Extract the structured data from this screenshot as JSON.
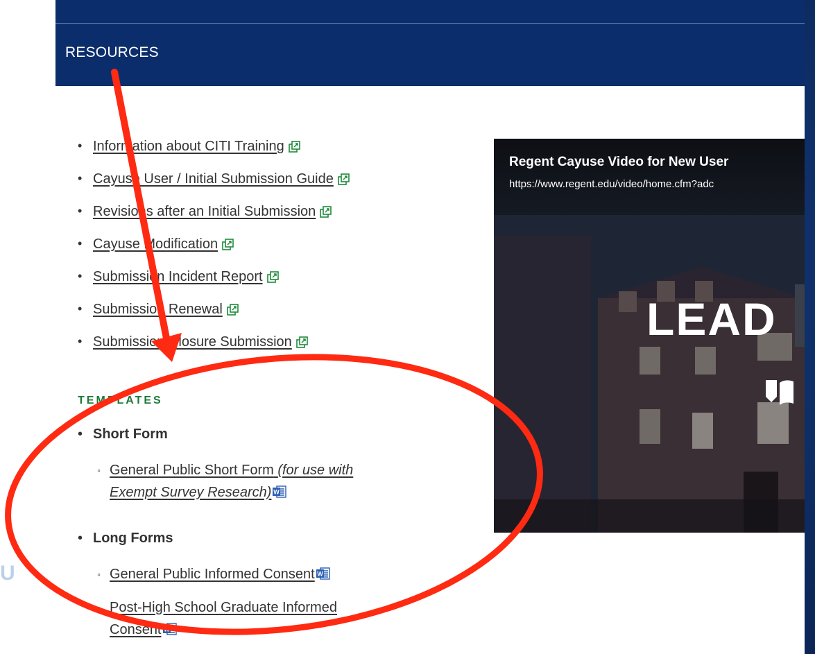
{
  "header": {
    "title": "RESOURCES"
  },
  "resources": [
    {
      "label": "Information about CITI Training"
    },
    {
      "label": "Cayuse User / Initial Submission Guide"
    },
    {
      "label": "Revisions after an Initial Submission"
    },
    {
      "label": "Cayuse Modification"
    },
    {
      "label": "Submission Incident Report"
    },
    {
      "label": "Submission Renewal"
    },
    {
      "label": "Submission Closure Submission"
    }
  ],
  "templates": {
    "heading": "TEMPLATES",
    "short_form": {
      "label": "Short Form",
      "items": [
        {
          "label": "General Public Short Form",
          "note_line1": "(for use with",
          "note_line2": "Exempt Survey Research)"
        }
      ]
    },
    "long_forms": {
      "label": "Long Forms",
      "items": [
        {
          "label": "General Public Informed Consent"
        },
        {
          "label_line1": "Post-High School Graduate Informed",
          "label_line2": "Consent"
        }
      ]
    }
  },
  "video": {
    "title": "Regent Cayuse Video for New User",
    "url": "https://www.regent.edu/video/home.cfm?adc",
    "overlay_text": "LEAD"
  },
  "icons": {
    "external_link": "external-link-icon",
    "word_doc": "word-document-icon"
  },
  "colors": {
    "header_bg": "#0b2d6b",
    "templates_heading": "#1d7a3a",
    "external_icon": "#1d8a3a",
    "word_icon": "#2b5fb4",
    "annotation": "#ff2a12"
  }
}
